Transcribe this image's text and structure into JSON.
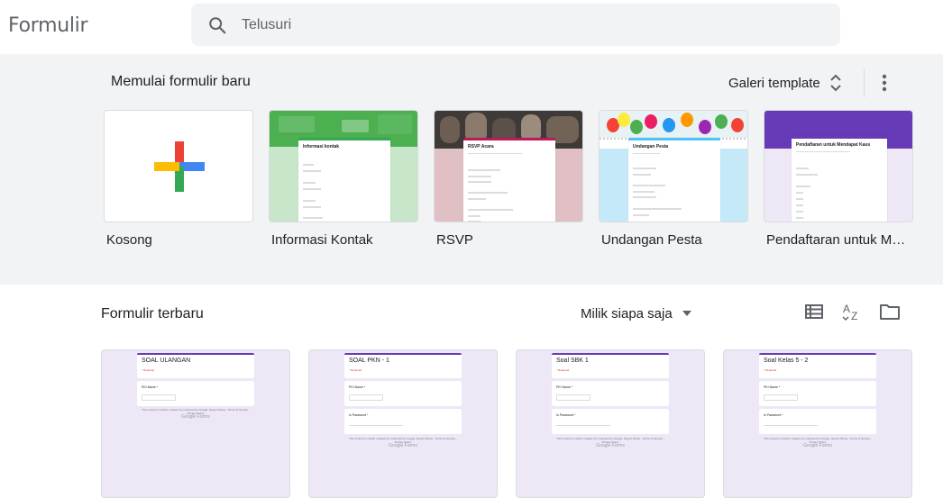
{
  "app": {
    "title": "Formulir"
  },
  "search": {
    "placeholder": "Telusuri"
  },
  "gallery": {
    "title": "Memulai formulir baru",
    "template_gallery_label": "Galeri template",
    "templates": [
      {
        "label": "Kosong",
        "form_title": ""
      },
      {
        "label": "Informasi Kontak",
        "form_title": "Informasi kontak",
        "color": "#34a853",
        "bg": "#c8e6c9"
      },
      {
        "label": "RSVP",
        "form_title": "RSVP Acara",
        "color": "#c2185b",
        "bg": "#e0c0c4"
      },
      {
        "label": "Undangan Pesta",
        "form_title": "Undangan Pesta",
        "color": "#4fc3f7",
        "bg": "#c6e9f9"
      },
      {
        "label": "Pendaftaran untuk Me...",
        "form_title": "Pendaftaran untuk Mendapat Kaus",
        "color": "#673ab7",
        "bg": "#ede7f6"
      }
    ]
  },
  "recent": {
    "title": "Formulir terbaru",
    "owner_filter": "Milik siapa saja",
    "forms": [
      {
        "title": "SOAL ULANGAN",
        "required": "* Required",
        "q1": "PKI Name *",
        "select": "Choose",
        "q2": "",
        "footer": "This content is neither created nor endorsed by Google. Report Abuse - Terms of Service - Privacy Policy",
        "brand": "Google Forms"
      },
      {
        "title": "SOAL PKN - 1",
        "required": "* Required",
        "q1": "PKI Name *",
        "select": "Choose",
        "q2": "Is Password *",
        "q2_hint": "Your answer",
        "footer": "This content is neither created nor endorsed by Google. Report Abuse - Terms of Service - Privacy Policy",
        "brand": "Google Forms"
      },
      {
        "title": "Soal SBK 1",
        "required": "* Required",
        "q1": "PKI Name *",
        "select": "Choose",
        "q2": "Is Password *",
        "q2_hint": "Your answer",
        "footer": "This content is neither created nor endorsed by Google. Report Abuse - Terms of Service - Privacy Policy",
        "brand": "Google Forms"
      },
      {
        "title": "Soal Kelas 5 - 2",
        "required": "* Required",
        "q1": "PKI Name *",
        "select": "Choose",
        "q2": "Is Password *",
        "q2_hint": "Your answer",
        "footer": "This content is neither created nor endorsed by Google. Report Abuse - Terms of Service - Privacy Policy",
        "brand": "Google Forms"
      }
    ]
  },
  "colors": {
    "accent": "#673ab7",
    "gallery_bg": "#f1f3f4",
    "doc_bg": "#ede7f6"
  },
  "icons": [
    "search-icon",
    "unfold-icon",
    "more-vert-icon",
    "dropdown-arrow-icon",
    "list-view-icon",
    "sort-az-icon",
    "folder-icon",
    "plus-icon"
  ]
}
